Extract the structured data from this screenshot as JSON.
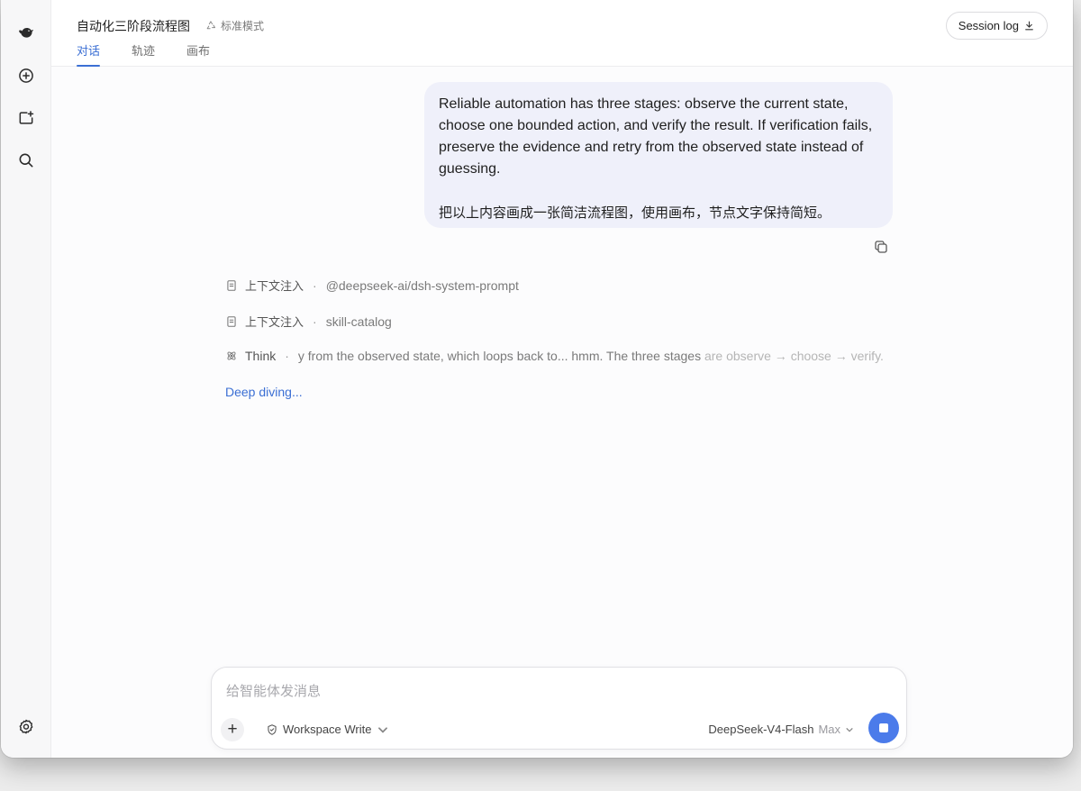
{
  "header": {
    "title": "自动化三阶段流程图",
    "mode": "标准模式",
    "tabs": [
      {
        "label": "对话",
        "active": true
      },
      {
        "label": "轨迹",
        "active": false
      },
      {
        "label": "画布",
        "active": false
      }
    ],
    "session_button": "Session log"
  },
  "rail": {
    "icons": [
      "deepseek-logo-icon",
      "new-chat-icon",
      "new-folder-icon",
      "search-icon",
      "settings-icon"
    ]
  },
  "message": {
    "text_en": "Reliable automation has three stages: observe the current state, choose one bounded action, and verify the result. If verification fails, preserve the evidence and retry from the observed state instead of guessing.",
    "text_cn": "把以上内容画成一张简洁流程图，使用画布，节点文字保持简短。"
  },
  "traces": [
    {
      "icon": "document-icon",
      "label": "上下文注入",
      "detail": "@deepseek-ai/dsh-system-prompt",
      "detail_faded": ""
    },
    {
      "icon": "document-icon",
      "label": "上下文注入",
      "detail": "skill-catalog",
      "detail_faded": ""
    },
    {
      "icon": "atom-icon",
      "label": "Think",
      "detail": "y from the observed state, which loops back to... hmm. The three stages",
      "detail_faded": " are observe → choose → verify."
    }
  ],
  "status": "Deep diving...",
  "composer": {
    "placeholder": "给智能体发消息",
    "permission": "Workspace Write",
    "model": "DeepSeek-V4-Flash",
    "effort": "Max"
  },
  "colors": {
    "accent": "#3b6fd4",
    "bubble": "#eff0fa",
    "send": "#4b7bea"
  }
}
